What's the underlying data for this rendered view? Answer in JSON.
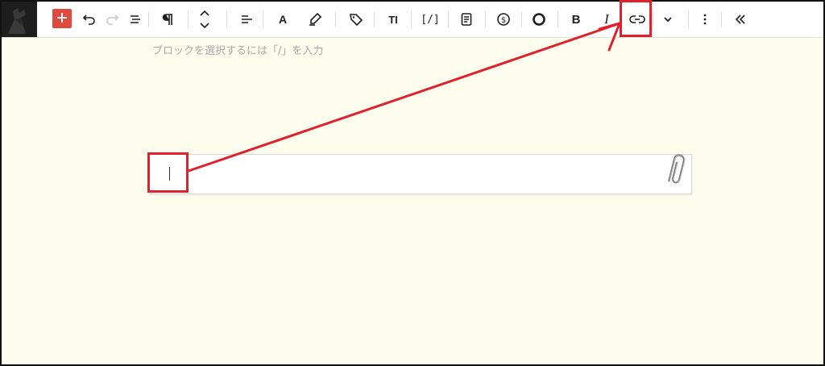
{
  "placeholder_hint": "ブロックを選択するには「/」を入力",
  "toolbar": {
    "heading_glyph": "A",
    "text_size_glyph": "TI",
    "shortcode_glyph": "[/]",
    "bold_glyph": "B",
    "italic_glyph": "I"
  },
  "colors": {
    "canvas_bg": "#fdfdee",
    "add_button": "#e04a3c",
    "annotation_red": "#e0202a"
  },
  "icons": [
    "logo-icon",
    "plus-icon",
    "undo-icon",
    "redo-icon",
    "list-view-icon",
    "paragraph-icon",
    "move-up-down-icon",
    "align-icon",
    "heading-icon",
    "highlighter-icon",
    "tag-icon",
    "text-size-icon",
    "shortcode-icon",
    "document-icon",
    "dollar-icon",
    "circle-icon",
    "bold-icon",
    "italic-icon",
    "link-icon",
    "chevron-down-icon",
    "more-vertical-icon",
    "collapse-icon",
    "paperclip-icon"
  ]
}
